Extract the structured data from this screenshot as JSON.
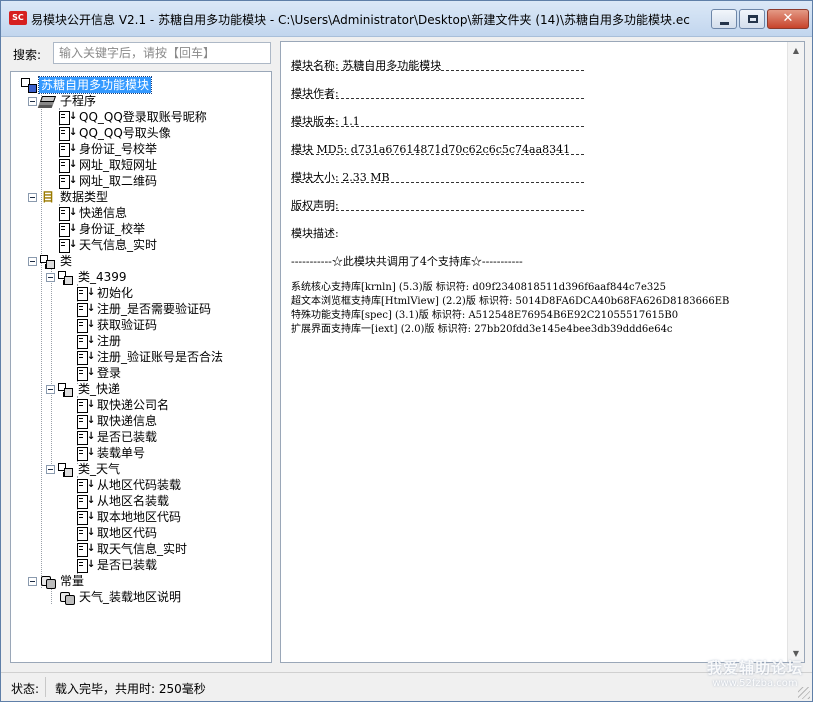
{
  "window": {
    "title": "易模块公开信息 V2.1 - 苏糖自用多功能模块 - C:\\Users\\Administrator\\Desktop\\新建文件夹 (14)\\苏糖自用多功能模块.ec",
    "app_icon_text": "SC"
  },
  "search": {
    "label": "搜索:",
    "placeholder": "输入关键字后，请按【回车】"
  },
  "tree": {
    "root": "苏糖自用多功能模块",
    "subprograms": {
      "label": "子程序",
      "items": [
        "QQ_QQ登录取账号昵称",
        "QQ_QQ号取头像",
        "身份证_号校举",
        "网址_取短网址",
        "网址_取二维码"
      ]
    },
    "datatypes": {
      "label": "数据类型",
      "items": [
        "快递信息",
        "身份证_校举",
        "天气信息_实时"
      ]
    },
    "classes": {
      "label": "类",
      "groups": [
        {
          "label": "类_4399",
          "items": [
            "初始化",
            "注册_是否需要验证码",
            "获取验证码",
            "注册",
            "注册_验证账号是否合法",
            "登录"
          ]
        },
        {
          "label": "类_快递",
          "items": [
            "取快递公司名",
            "取快递信息",
            "是否已装载",
            "装载单号"
          ]
        },
        {
          "label": "类_天气",
          "items": [
            "从地区代码装载",
            "从地区名装载",
            "取本地地区代码",
            "取地区代码",
            "取天气信息_实时",
            "是否已装载"
          ]
        }
      ]
    },
    "constants": {
      "label": "常量",
      "items": [
        "天气_装载地区说明"
      ]
    }
  },
  "details": {
    "name": "模块名称: 苏糖自用多功能模块",
    "author": "模块作者:",
    "version": "模块版本: 1.1",
    "md5": "模块 MD5: d731a67614871d70c62c6c5c74aa8341",
    "size": "模块大小: 2.33 MB",
    "copyright": "版权声明:",
    "description": "模块描述:",
    "notice": "-----------☆此模块共调用了4个支持库☆-----------",
    "libraries": [
      "系统核心支持库[krnln] (5.3)版 标识符: d09f2340818511d396f6aaf844c7e325",
      "超文本浏览框支持库[HtmlView] (2.2)版 标识符: 5014D8FA6DCA40b68FA626D8183666EB",
      "特殊功能支持库[spec] (3.1)版 标识符: A512548E76954B6E92C21055517615B0",
      "扩展界面支持库一[iext] (2.0)版 标识符: 27bb20fdd3e145e4bee3db39ddd6e64c"
    ]
  },
  "status": {
    "label": "状态:",
    "text": "载入完毕，共用时: 250毫秒"
  },
  "watermark": {
    "title": "我爱辅助论坛",
    "url": "www.52fzba.com"
  }
}
